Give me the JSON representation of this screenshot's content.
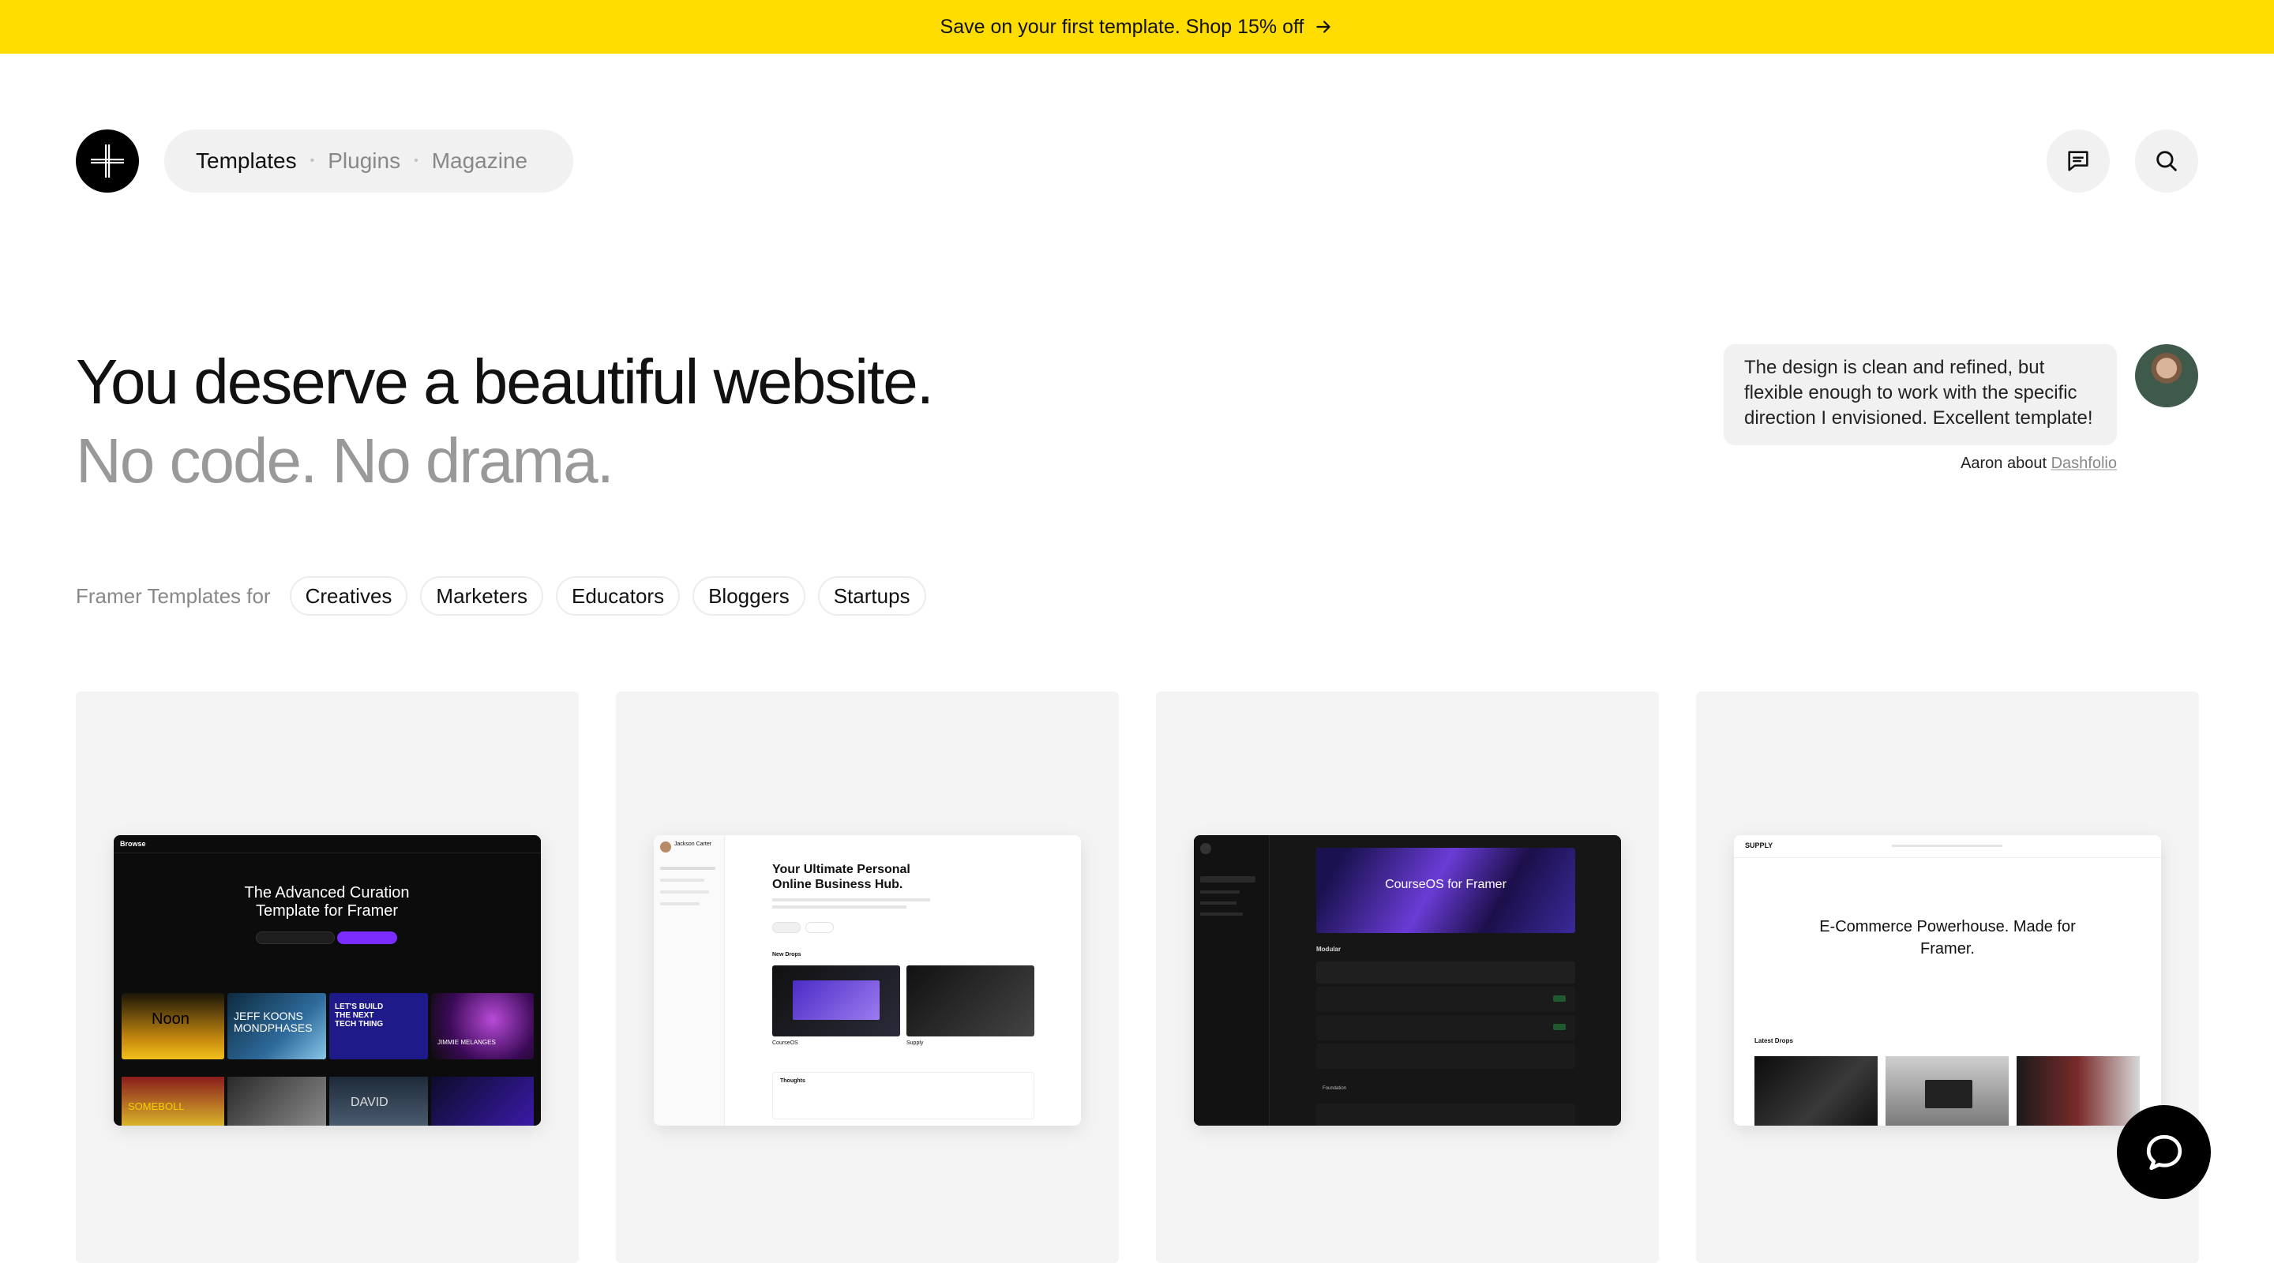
{
  "promo": {
    "text": "Save on your first template. Shop 15% off",
    "icon": "arrow-right-icon",
    "background": "#ffdd00"
  },
  "nav": {
    "items": [
      {
        "label": "Templates",
        "active": true
      },
      {
        "label": "Plugins",
        "active": false
      },
      {
        "label": "Magazine",
        "active": false
      }
    ]
  },
  "header_actions": {
    "feedback_icon": "message-square-icon",
    "search_icon": "search-icon"
  },
  "hero": {
    "line1": "You deserve a beautiful website.",
    "line2": "No code. No drama."
  },
  "testimonial": {
    "quote": "The design is clean and refined, but flexible enough to work with the specific direction I envisioned. Excellent template!",
    "author_prefix": "Aaron about",
    "template_link": "Dashfolio"
  },
  "categories": {
    "label": "Framer Templates for",
    "chips": [
      "Creatives",
      "Marketers",
      "Educators",
      "Bloggers",
      "Startups"
    ]
  },
  "cards": [
    {
      "theme": "dark",
      "heading": "The Advanced Curation Template for Framer",
      "brand": "Browse",
      "tiles": [
        "Noon",
        "JEFF KOONS MONDPHASES",
        "LET'S BUILD THE NEXT TECH THING",
        "JIMMIE MELANGES",
        "SOMEBOLL",
        "DAVID"
      ]
    },
    {
      "theme": "light",
      "heading": "Your Ultimate Personal Online Business Hub.",
      "section": "New Drops",
      "profile_name": "Jackson Carter",
      "items": [
        "CourseOS",
        "Supply"
      ],
      "thoughts": "Thoughts"
    },
    {
      "theme": "dark",
      "heading": "CourseOS for Framer",
      "section": "Modular",
      "subsection": "Foundation"
    },
    {
      "theme": "light",
      "heading": "E-Commerce Powerhouse. Made for Framer.",
      "brand": "SUPPLY",
      "section": "Latest Drops"
    }
  ],
  "chat_widget": {
    "icon": "chat-bubble-icon"
  }
}
